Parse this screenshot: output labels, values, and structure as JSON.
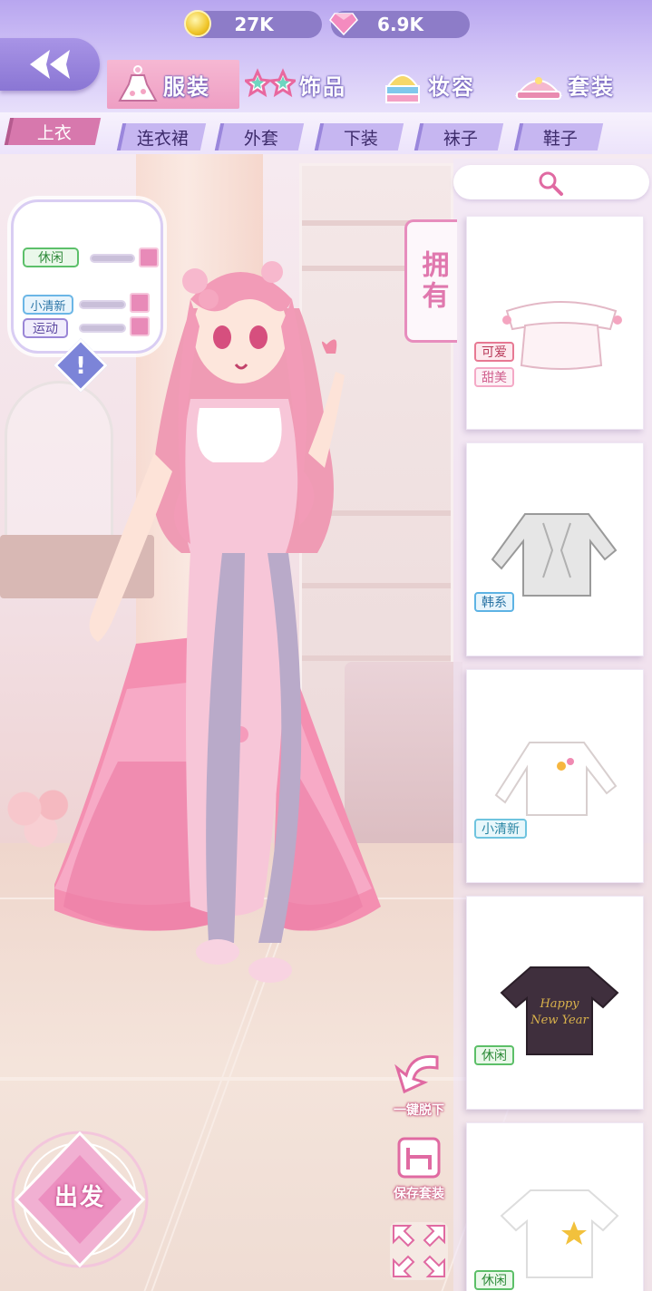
{
  "currency": {
    "coins": "27K",
    "gems": "6.9K"
  },
  "icons": {
    "back": "double-arrow-left-icon",
    "coin": "gold-coin-icon",
    "gem": "pink-diamond-icon"
  },
  "categories": [
    {
      "label": "服装",
      "icon": "dress-icon",
      "active": true
    },
    {
      "label": "饰品",
      "icon": "star-glasses-icon",
      "active": false
    },
    {
      "label": "妆容",
      "icon": "cake-makeup-icon",
      "active": false
    },
    {
      "label": "套装",
      "icon": "crown-icon",
      "active": false
    }
  ],
  "subtabs": [
    "上衣",
    "连衣裙",
    "外套",
    "下装",
    "袜子",
    "鞋子"
  ],
  "style_panel": {
    "tags": [
      "休闲",
      "小清新",
      "运动"
    ]
  },
  "own_tab": "拥有",
  "items": [
    {
      "name": "pink-off-shoulder-top",
      "tags": [
        "可爱",
        "甜美"
      ]
    },
    {
      "name": "gray-knit-sweater",
      "tags": [
        "韩系"
      ]
    },
    {
      "name": "white-flower-longsleeve",
      "tags": [
        "小清新"
      ]
    },
    {
      "name": "dark-happy-new-year-tee",
      "tags": [
        "休闲"
      ],
      "print": "Happy New Year"
    },
    {
      "name": "white-star-tee",
      "tags": [
        "休闲"
      ]
    }
  ],
  "actions": {
    "undress": "一键脱下",
    "save_outfit": "保存套装",
    "go": "出发"
  },
  "colors": {
    "accent_pink": "#e88ab8",
    "header_purple": "#b8a6ef",
    "active_subtab": "#d778ad"
  }
}
